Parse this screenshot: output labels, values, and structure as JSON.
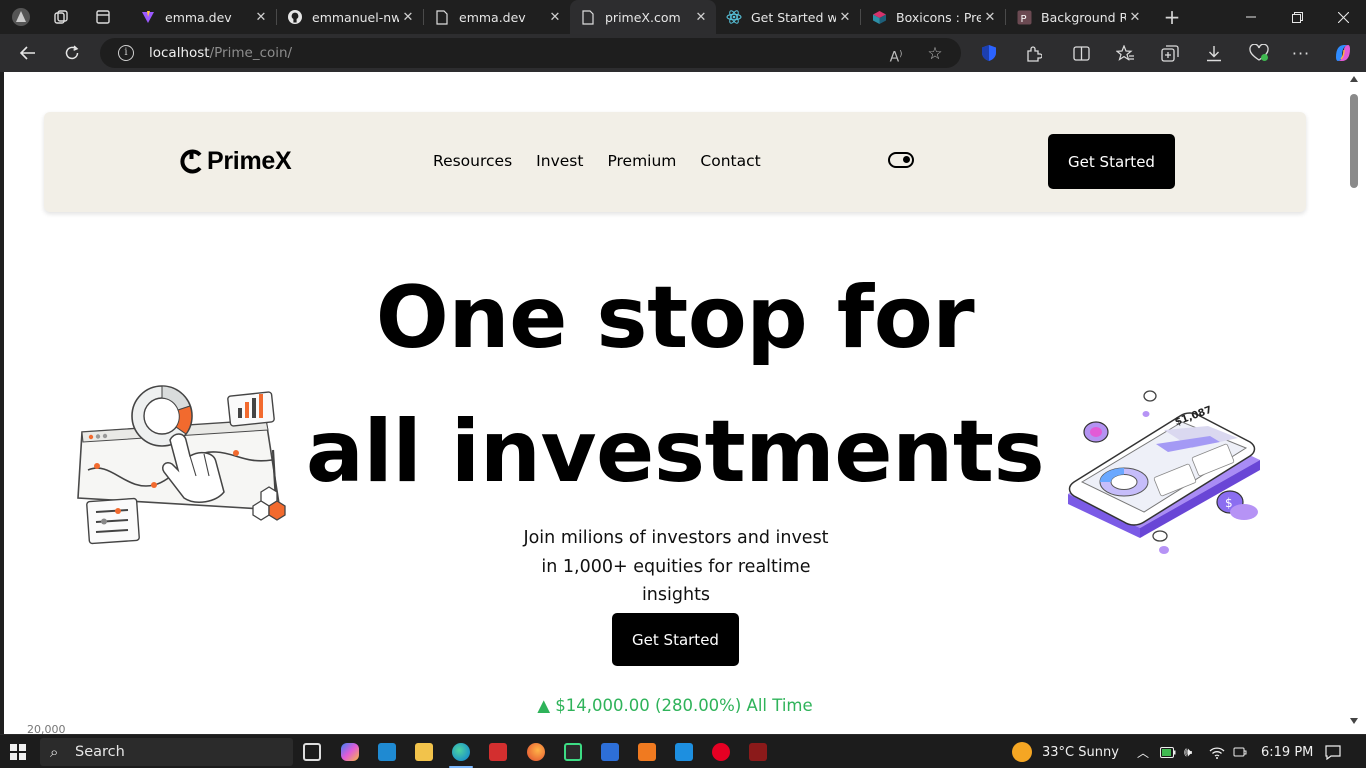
{
  "browser": {
    "tabs": [
      {
        "title": "emma.dev",
        "icon": "vite-icon",
        "active": false
      },
      {
        "title": "emmanuel-nwaf",
        "icon": "github-icon",
        "active": false
      },
      {
        "title": "emma.dev",
        "icon": "page-icon",
        "active": false
      },
      {
        "title": "primeX.com",
        "icon": "page-icon",
        "active": true
      },
      {
        "title": "Get Started with",
        "icon": "react-icon",
        "active": false
      },
      {
        "title": "Boxicons : Prem",
        "icon": "boxicons-icon",
        "active": false
      },
      {
        "title": "Background Re",
        "icon": "photoroom-icon",
        "active": false
      }
    ],
    "address": {
      "host": "localhost",
      "path": "/Prime_coin/"
    }
  },
  "site": {
    "logo": "PrimeX",
    "nav": [
      "Resources",
      "Invest",
      "Premium",
      "Contact"
    ],
    "header_cta": "Get Started",
    "hero_line1": "One stop for",
    "hero_line2": "all investments",
    "subtext": "Join milions of investors and invest in 1,000+ equities for realtime insights",
    "hero_cta": "Get Started",
    "gain_arrow": "▲",
    "gain_text": "$14,000.00 (280.00%) All Time",
    "chart_axis_label": "20,000",
    "phone_amount": "$1,087"
  },
  "taskbar": {
    "search_label": "Search",
    "weather": "33°C  Sunny",
    "time": "6:19 PM"
  },
  "colors": {
    "nav_bg": "#f2efe7",
    "cta_bg": "#000000",
    "gain": "#2fb35a",
    "accent_orange": "#f26a2e",
    "accent_purple": "#8b6ef0"
  }
}
